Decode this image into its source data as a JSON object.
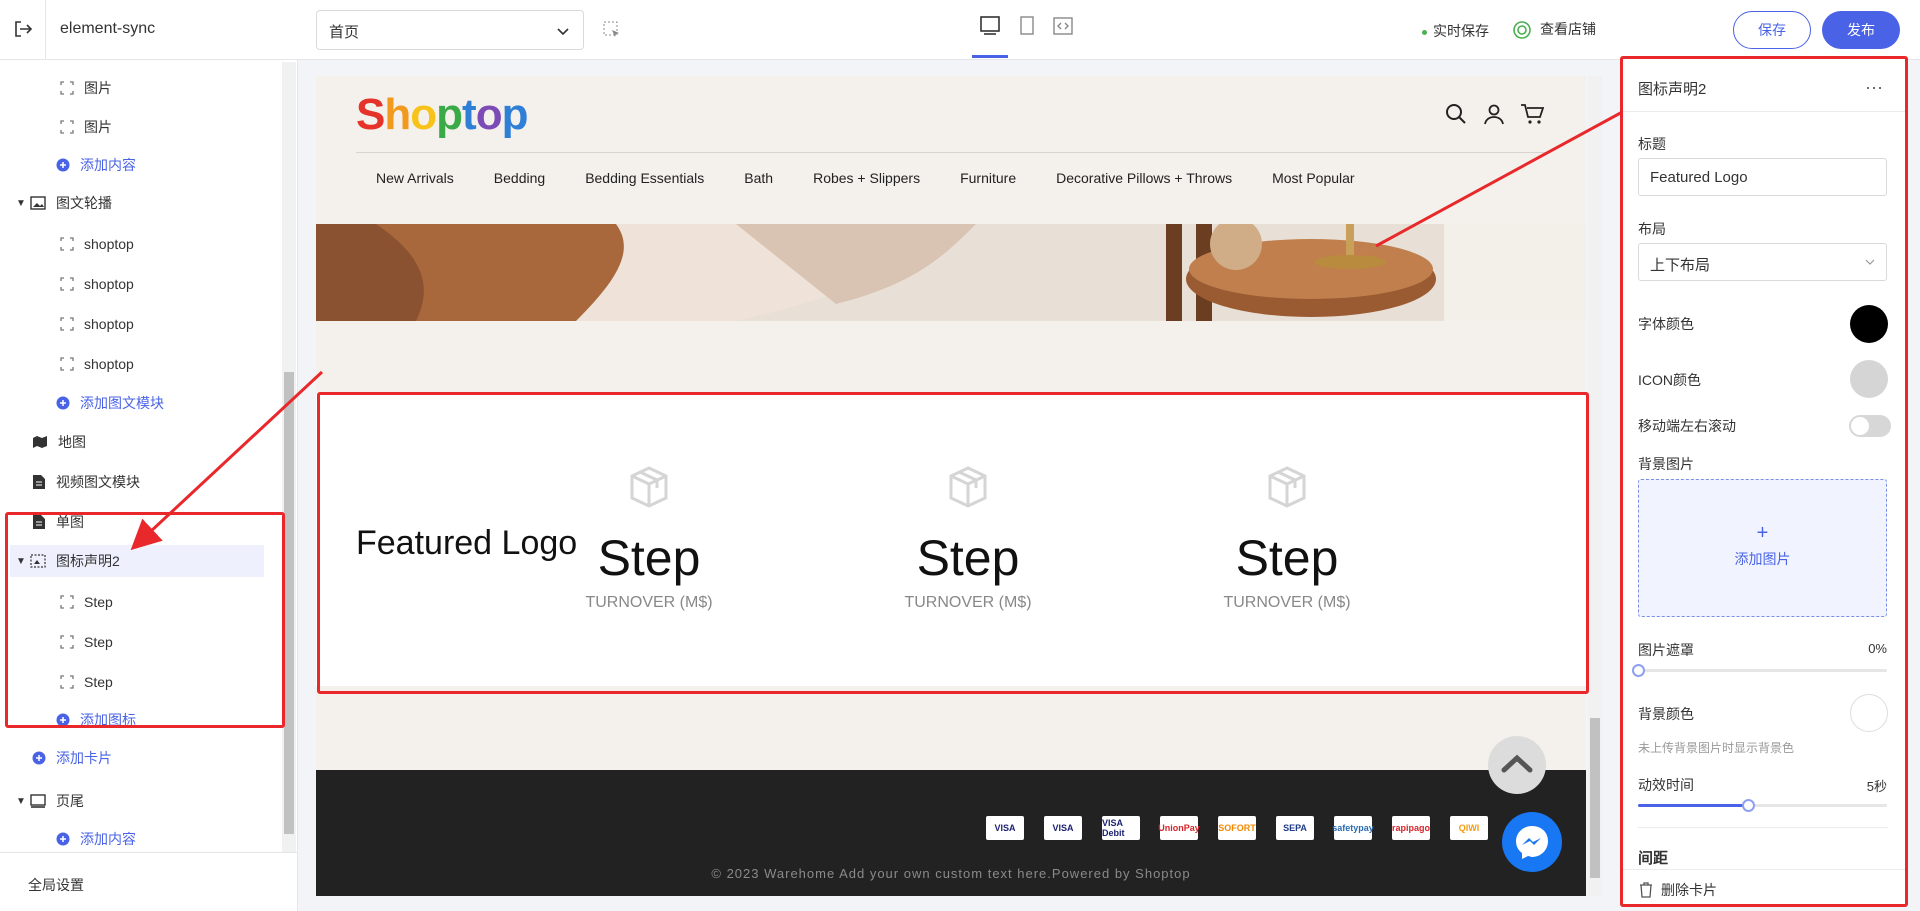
{
  "topbar": {
    "app_name": "element-sync",
    "page_select": "首页",
    "autosave": "实时保存",
    "view_store": "查看店铺",
    "save": "保存",
    "publish": "发布"
  },
  "sidebar": {
    "items": [
      {
        "label": "图片",
        "type": "child"
      },
      {
        "label": "图片",
        "type": "child"
      },
      {
        "label": "添加内容",
        "type": "add-child"
      },
      {
        "label": "图文轮播",
        "type": "group"
      },
      {
        "label": "shoptop",
        "type": "child"
      },
      {
        "label": "shoptop",
        "type": "child"
      },
      {
        "label": "shoptop",
        "type": "child"
      },
      {
        "label": "shoptop",
        "type": "child"
      },
      {
        "label": "添加图文模块",
        "type": "add-child"
      },
      {
        "label": "地图",
        "type": "module"
      },
      {
        "label": "视频图文模块",
        "type": "module"
      },
      {
        "label": "单图",
        "type": "module"
      },
      {
        "label": "图标声明2",
        "type": "group-selected"
      },
      {
        "label": "Step",
        "type": "child"
      },
      {
        "label": "Step",
        "type": "child"
      },
      {
        "label": "Step",
        "type": "child"
      },
      {
        "label": "添加图标",
        "type": "add-child"
      },
      {
        "label": "添加卡片",
        "type": "add-root"
      },
      {
        "label": "页尾",
        "type": "group"
      },
      {
        "label": "添加内容",
        "type": "add-child"
      }
    ],
    "global_settings": "全局设置"
  },
  "preview": {
    "logo_letters": [
      "S",
      "h",
      "o",
      "p",
      "t",
      "o",
      "p"
    ],
    "logo_colors": [
      "#e6332a",
      "#f29a1f",
      "#f7c21a",
      "#3aaa49",
      "#2f7fd6",
      "#7d4bb5",
      "#2f7fd6"
    ],
    "nav": [
      "New Arrivals",
      "Bedding",
      "Bedding Essentials",
      "Bath",
      "Robes + Slippers",
      "Furniture",
      "Decorative Pillows + Throws",
      "Most Popular"
    ],
    "featured_title": "Featured Logo",
    "steps": [
      {
        "title": "Step",
        "subtitle": "TURNOVER (M$)"
      },
      {
        "title": "Step",
        "subtitle": "TURNOVER (M$)"
      },
      {
        "title": "Step",
        "subtitle": "TURNOVER (M$)"
      }
    ],
    "payment_methods": [
      "VISA",
      "VISA",
      "VISA Debit",
      "UnionPay",
      "SOFORT",
      "SEPA",
      "safetypay",
      "rapipago",
      "QIWI"
    ],
    "copyright": "© 2023 Warehome Add your own custom text here.Powered by Shoptop"
  },
  "panel": {
    "title": "图标声明2",
    "title_label": "标题",
    "title_value": "Featured Logo",
    "layout_label": "布局",
    "layout_value": "上下布局",
    "font_color_label": "字体颜色",
    "font_color": "#000000",
    "icon_color_label": "ICON颜色",
    "icon_color": "#d5d5d5",
    "mobile_scroll_label": "移动端左右滚动",
    "mobile_scroll": false,
    "bg_image_label": "背景图片",
    "add_image": "添加图片",
    "mask_label": "图片遮罩",
    "mask_value": "0%",
    "mask_fraction": 0,
    "bg_color_label": "背景颜色",
    "bg_color": "#ffffff",
    "bg_hint": "未上传背景图片时显示背景色",
    "anim_label": "动效时间",
    "anim_value": "5秒",
    "anim_fraction": 0.44,
    "spacing_label": "间距",
    "delete_card": "删除卡片"
  }
}
